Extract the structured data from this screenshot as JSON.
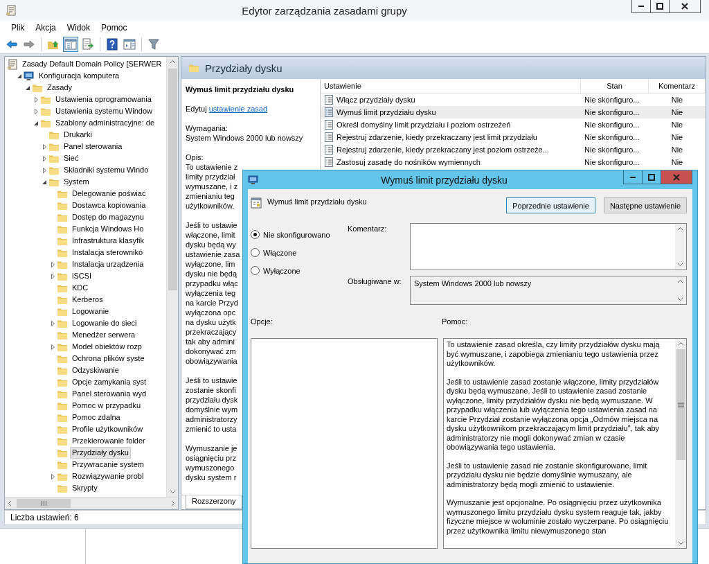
{
  "window": {
    "title": "Edytor zarządzania zasadami grupy"
  },
  "menu": [
    "Plik",
    "Akcja",
    "Widok",
    "Pomoc"
  ],
  "toolbar": [
    {
      "kind": "back",
      "pressed": false
    },
    {
      "kind": "forward",
      "pressed": false
    },
    {
      "kind": "separator"
    },
    {
      "kind": "up",
      "pressed": false
    },
    {
      "kind": "tree",
      "pressed": true
    },
    {
      "kind": "export",
      "pressed": false
    },
    {
      "kind": "separator"
    },
    {
      "kind": "help",
      "pressed": false
    },
    {
      "kind": "pane",
      "pressed": false
    },
    {
      "kind": "separator"
    },
    {
      "kind": "filter",
      "pressed": false
    }
  ],
  "tree": [
    {
      "label": "Zasady Default Domain Policy [SERWER",
      "kind": "policy",
      "selected": false,
      "children": [
        {
          "label": "Konfiguracja komputera",
          "kind": "computer",
          "expanded": true,
          "selected": false,
          "children": [
            {
              "label": "Zasady",
              "kind": "folder",
              "expanded": true,
              "selected": false,
              "children": [
                {
                  "label": "Ustawienia oprogramowania",
                  "kind": "folder",
                  "expanded": false,
                  "selected": false
                },
                {
                  "label": "Ustawienia systemu Window",
                  "kind": "folder",
                  "expanded": false,
                  "selected": false
                },
                {
                  "label": "Szablony administracyjne: de",
                  "kind": "folder",
                  "expanded": true,
                  "selected": false,
                  "children": [
                    {
                      "label": "Drukarki",
                      "kind": "folder",
                      "selected": false
                    },
                    {
                      "label": "Panel sterowania",
                      "kind": "folder",
                      "expanded": false,
                      "selected": false
                    },
                    {
                      "label": "Sieć",
                      "kind": "folder",
                      "expanded": false,
                      "selected": false
                    },
                    {
                      "label": "Składniki systemu Windo",
                      "kind": "folder",
                      "expanded": false,
                      "selected": false
                    },
                    {
                      "label": "System",
                      "kind": "folder",
                      "expanded": true,
                      "selected": false,
                      "children": [
                        {
                          "label": "Delegowanie poświac",
                          "kind": "folder",
                          "selected": false
                        },
                        {
                          "label": "Dostawca kopiowania",
                          "kind": "folder",
                          "selected": false
                        },
                        {
                          "label": "Dostęp do magazynu",
                          "kind": "folder",
                          "selected": false
                        },
                        {
                          "label": "Funkcja Windows Ho",
                          "kind": "folder",
                          "selected": false
                        },
                        {
                          "label": "Infrastruktura klasyfik",
                          "kind": "folder",
                          "selected": false
                        },
                        {
                          "label": "Instalacja sterownikó",
                          "kind": "folder",
                          "selected": false
                        },
                        {
                          "label": "Instalacja urządzenia",
                          "kind": "folder",
                          "expanded": false,
                          "selected": false
                        },
                        {
                          "label": "iSCSI",
                          "kind": "folder",
                          "expanded": false,
                          "selected": false
                        },
                        {
                          "label": "KDC",
                          "kind": "folder",
                          "selected": false
                        },
                        {
                          "label": "Kerberos",
                          "kind": "folder",
                          "selected": false
                        },
                        {
                          "label": "Logowanie",
                          "kind": "folder",
                          "selected": false
                        },
                        {
                          "label": "Logowanie do sieci",
                          "kind": "folder",
                          "expanded": false,
                          "selected": false
                        },
                        {
                          "label": "Menedżer serwera",
                          "kind": "folder",
                          "selected": false
                        },
                        {
                          "label": "Model obiektów rozp",
                          "kind": "folder",
                          "expanded": false,
                          "selected": false
                        },
                        {
                          "label": "Ochrona plików syste",
                          "kind": "folder",
                          "selected": false
                        },
                        {
                          "label": "Odzyskiwanie",
                          "kind": "folder",
                          "selected": false
                        },
                        {
                          "label": "Opcje zamykania syst",
                          "kind": "folder",
                          "selected": false
                        },
                        {
                          "label": "Panel sterowania wyd",
                          "kind": "folder",
                          "selected": false
                        },
                        {
                          "label": "Pomoc w przypadku",
                          "kind": "folder",
                          "selected": false
                        },
                        {
                          "label": "Pomoc zdalna",
                          "kind": "folder",
                          "selected": false
                        },
                        {
                          "label": "Profile użytkowników",
                          "kind": "folder",
                          "selected": false
                        },
                        {
                          "label": "Przekierowanie folder",
                          "kind": "folder",
                          "selected": false
                        },
                        {
                          "label": "Przydziały dysku",
                          "kind": "folder",
                          "selected": true
                        },
                        {
                          "label": "Przywracanie system",
                          "kind": "folder",
                          "selected": false
                        },
                        {
                          "label": "Rozwiązywanie probl",
                          "kind": "folder",
                          "expanded": false,
                          "selected": false
                        },
                        {
                          "label": "Skrypty",
                          "kind": "folder",
                          "selected": false
                        }
                      ]
                    }
                  ]
                }
              ]
            }
          ]
        }
      ]
    }
  ],
  "panel_title": "Przydziały dysku",
  "description": {
    "title": "Wymuś limit przydziału dysku",
    "edit_prefix": "Edytuj",
    "edit_link": "ustawienie zasad",
    "requirements_label": "Wymagania:",
    "requirements": "System Windows 2000 lub nowszy",
    "description_label": "Opis:",
    "paragraphs": [
      [
        "To ustawienie z",
        "limity przydział",
        "wymuszane, i z",
        "zmienianiu teg",
        "użytkowników."
      ],
      [
        "Jeśli to ustawie",
        "włączone, limit",
        "dysku będą wy",
        "ustawienie zasa",
        "wyłączone, lim",
        "dysku nie będą",
        "przypadku włąc",
        "wyłączenia teg",
        "na karcie Przyd",
        "wyłączona opc",
        "na dysku użytk",
        "przekraczający",
        "tak aby admini",
        "dokonywać zm",
        "obowiązywania"
      ],
      [
        "Jeśli to ustawie",
        "zostanie skonfi",
        "przydziału dysk",
        "domyślnie wym",
        "administratorzy",
        "zmienić to usta"
      ],
      [
        "Wymuszanie je",
        "osiągnięciu prz",
        "wymuszonego",
        "dysku system r"
      ]
    ],
    "tab": "Rozszerzony"
  },
  "list": {
    "columns": [
      "Ustawienie",
      "Stan",
      "Komentarz"
    ],
    "rows": [
      {
        "setting": "Włącz przydziały dysku",
        "state": "Nie skonfiguro...",
        "comment": "Nie",
        "selected": false
      },
      {
        "setting": "Wymuś limit przydziału dysku",
        "state": "Nie skonfiguro...",
        "comment": "Nie",
        "selected": true
      },
      {
        "setting": "Określ domyślny limit przydziału i poziom ostrzeżeń",
        "state": "Nie skonfiguro...",
        "comment": "Nie",
        "selected": false
      },
      {
        "setting": "Rejestruj zdarzenie, kiedy przekraczany jest limit przydziału",
        "state": "Nie skonfiguro...",
        "comment": "Nie",
        "selected": false
      },
      {
        "setting": "Rejestruj zdarzenie, kiedy przekraczany jest poziom ostrzeże...",
        "state": "Nie skonfiguro...",
        "comment": "Nie",
        "selected": false
      },
      {
        "setting": "Zastosuj zasadę do nośników wymiennych",
        "state": "Nie skonfiguro...",
        "comment": "Nie",
        "selected": false
      }
    ]
  },
  "status_bar": "Liczba ustawień: 6",
  "dialog": {
    "title": "Wymuś limit przydziału dysku",
    "setting_name": "Wymuś limit przydziału dysku",
    "buttons": [
      {
        "label": "Poprzednie ustawienie",
        "focused": true
      },
      {
        "label": "Następne ustawienie",
        "focused": false
      }
    ],
    "options": [
      {
        "label": "Nie skonfigurowano",
        "selected": true
      },
      {
        "label": "Włączone",
        "selected": false
      },
      {
        "label": "Wyłączone",
        "selected": false
      }
    ],
    "comment_label": "Komentarz:",
    "supported_label": "Obsługiwane w:",
    "supported_value": "System Windows 2000 lub nowszy",
    "options_label": "Opcje:",
    "help_label": "Pomoc:",
    "help_paragraphs": [
      "To ustawienie zasad określa, czy limity przydziałów dysku mają być wymuszane, i zapobiega zmienianiu tego ustawienia przez użytkowników.",
      "Jeśli to ustawienie zasad zostanie włączone, limity przydziałów dysku będą wymuszane. Jeśli to ustawienie zasad zostanie wyłączone, limity przydziałów dysku nie będą wymuszane. W przypadku włączenia lub wyłączenia tego ustawienia zasad na karcie Przydział zostanie wyłączona opcja „Odmów miejsca na dysku użytkownikom przekraczającym limit przydziału\", tak aby administratorzy nie mogli dokonywać zmian w czasie obowiązywania tego ustawienia.",
      "Jeśli to ustawienie zasad nie zostanie skonfigurowane, limit przydziału dysku nie będzie domyślnie wymuszany, ale administratorzy będą mogli zmienić to ustawienie.",
      "Wymuszanie jest opcjonalne. Po osiągnięciu przez użytkownika wymuszonego limitu przydziału dysku system reaguje tak, jakby fizyczne miejsce w woluminie zostało wyczerpane. Po osiągnięciu przez użytkownika limitu niewymuszonego stan"
    ]
  }
}
